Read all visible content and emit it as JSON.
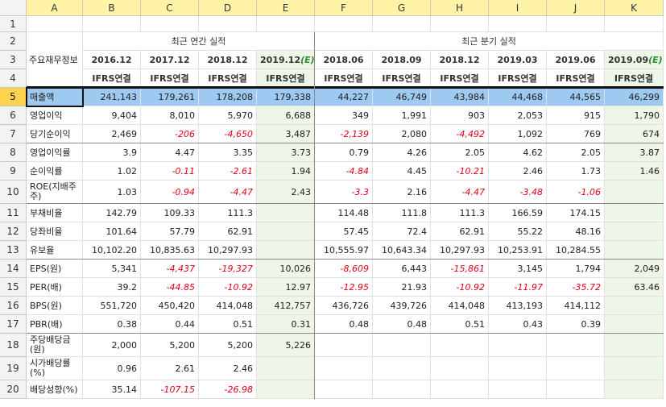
{
  "columns": [
    "A",
    "B",
    "C",
    "D",
    "E",
    "F",
    "G",
    "H",
    "I",
    "J",
    "K"
  ],
  "rows": [
    "1",
    "2",
    "3",
    "4",
    "5",
    "6",
    "7",
    "8",
    "9",
    "10",
    "11",
    "12",
    "13",
    "14",
    "15",
    "16",
    "17",
    "18",
    "19",
    "20"
  ],
  "header": {
    "label": "주요재무정보",
    "annual_group": "최근 연간 실적",
    "quarterly_group": "최근 분기 실적",
    "periods": [
      "2016.12",
      "2017.12",
      "2018.12",
      "2019.12",
      "2018.06",
      "2018.09",
      "2018.12",
      "2019.03",
      "2019.06",
      "2019.09"
    ],
    "estimate_suffix": "(E)",
    "basis": "IFRS연결"
  },
  "table": [
    {
      "label": "매출액",
      "values": [
        "241,143",
        "179,261",
        "178,208",
        "179,338",
        "44,227",
        "46,749",
        "43,984",
        "44,468",
        "44,565",
        "46,299"
      ]
    },
    {
      "label": "영업이익",
      "values": [
        "9,404",
        "8,010",
        "5,970",
        "6,688",
        "349",
        "1,991",
        "903",
        "2,053",
        "915",
        "1,790"
      ]
    },
    {
      "label": "당기순이익",
      "values": [
        "2,469",
        "-206",
        "-4,650",
        "3,487",
        "-2,139",
        "2,080",
        "-4,492",
        "1,092",
        "769",
        "674"
      ]
    },
    {
      "label": "영업이익률",
      "values": [
        "3.9",
        "4.47",
        "3.35",
        "3.73",
        "0.79",
        "4.26",
        "2.05",
        "4.62",
        "2.05",
        "3.87"
      ]
    },
    {
      "label": "순이익률",
      "values": [
        "1.02",
        "-0.11",
        "-2.61",
        "1.94",
        "-4.84",
        "4.45",
        "-10.21",
        "2.46",
        "1.73",
        "1.46"
      ]
    },
    {
      "label": "ROE(지배주주)",
      "values": [
        "1.03",
        "-0.94",
        "-4.47",
        "2.43",
        "-3.3",
        "2.16",
        "-4.47",
        "-3.48",
        "-1.06",
        ""
      ]
    },
    {
      "label": "부채비율",
      "values": [
        "142.79",
        "109.33",
        "111.3",
        "",
        "114.48",
        "111.8",
        "111.3",
        "166.59",
        "174.15",
        ""
      ]
    },
    {
      "label": "당좌비율",
      "values": [
        "101.64",
        "57.79",
        "62.91",
        "",
        "57.45",
        "72.4",
        "62.91",
        "55.22",
        "48.16",
        ""
      ]
    },
    {
      "label": "유보율",
      "values": [
        "10,102.20",
        "10,835.63",
        "10,297.93",
        "",
        "10,555.97",
        "10,643.34",
        "10,297.93",
        "10,253.91",
        "10,284.55",
        ""
      ]
    },
    {
      "label": "EPS(원)",
      "values": [
        "5,341",
        "-4,437",
        "-19,327",
        "10,026",
        "-8,609",
        "6,443",
        "-15,861",
        "3,145",
        "1,794",
        "2,049"
      ]
    },
    {
      "label": "PER(배)",
      "values": [
        "39.2",
        "-44.85",
        "-10.92",
        "12.97",
        "-12.95",
        "21.93",
        "-10.92",
        "-11.97",
        "-35.72",
        "63.46"
      ]
    },
    {
      "label": "BPS(원)",
      "values": [
        "551,720",
        "450,420",
        "414,048",
        "412,757",
        "436,726",
        "439,726",
        "414,048",
        "413,193",
        "414,112",
        ""
      ]
    },
    {
      "label": "PBR(배)",
      "values": [
        "0.38",
        "0.44",
        "0.51",
        "0.31",
        "0.48",
        "0.48",
        "0.51",
        "0.43",
        "0.39",
        ""
      ]
    },
    {
      "label": "주당배당금(원)",
      "values": [
        "2,000",
        "5,200",
        "5,200",
        "5,226",
        "",
        "",
        "",
        "",
        "",
        ""
      ]
    },
    {
      "label": "시가배당률(%)",
      "values": [
        "0.96",
        "2.61",
        "2.46",
        "",
        "",
        "",
        "",
        "",
        "",
        ""
      ]
    },
    {
      "label": "배당성향(%)",
      "values": [
        "35.14",
        "-107.15",
        "-26.98",
        "",
        "",
        "",
        "",
        "",
        "",
        ""
      ]
    }
  ],
  "colors": {
    "selected_row": "#9ec9f0",
    "estimate_bg": "#eef6e8",
    "negative": "#e0001b",
    "col_header": "#fff3a8"
  }
}
